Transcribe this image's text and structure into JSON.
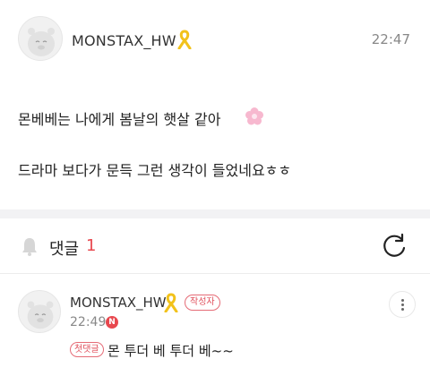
{
  "post": {
    "author": "MONSTAX_HW",
    "time": "22:47",
    "line1": "몬베베는 나에게 봄날의 햇살 같아",
    "line2": "드라마 보다가 문득 그런 생각이 들었네요ㅎㅎ"
  },
  "comments_section": {
    "label": "댓글",
    "count": "1"
  },
  "comment": {
    "author": "MONSTAX_HW",
    "writer_badge": "작성자",
    "time": "22:49",
    "new_badge": "N",
    "first_badge": "첫댓글",
    "text": "몬 투더 베 투더 베~~"
  },
  "colors": {
    "accent": "#e8484f",
    "ribbon": "#f2c21b",
    "divider": "#f2f2f4"
  },
  "icons": [
    "avatar-icon",
    "yellow-ribbon-icon",
    "pink-flower-emoji",
    "bell-icon",
    "refresh-icon",
    "more-vertical-icon"
  ]
}
